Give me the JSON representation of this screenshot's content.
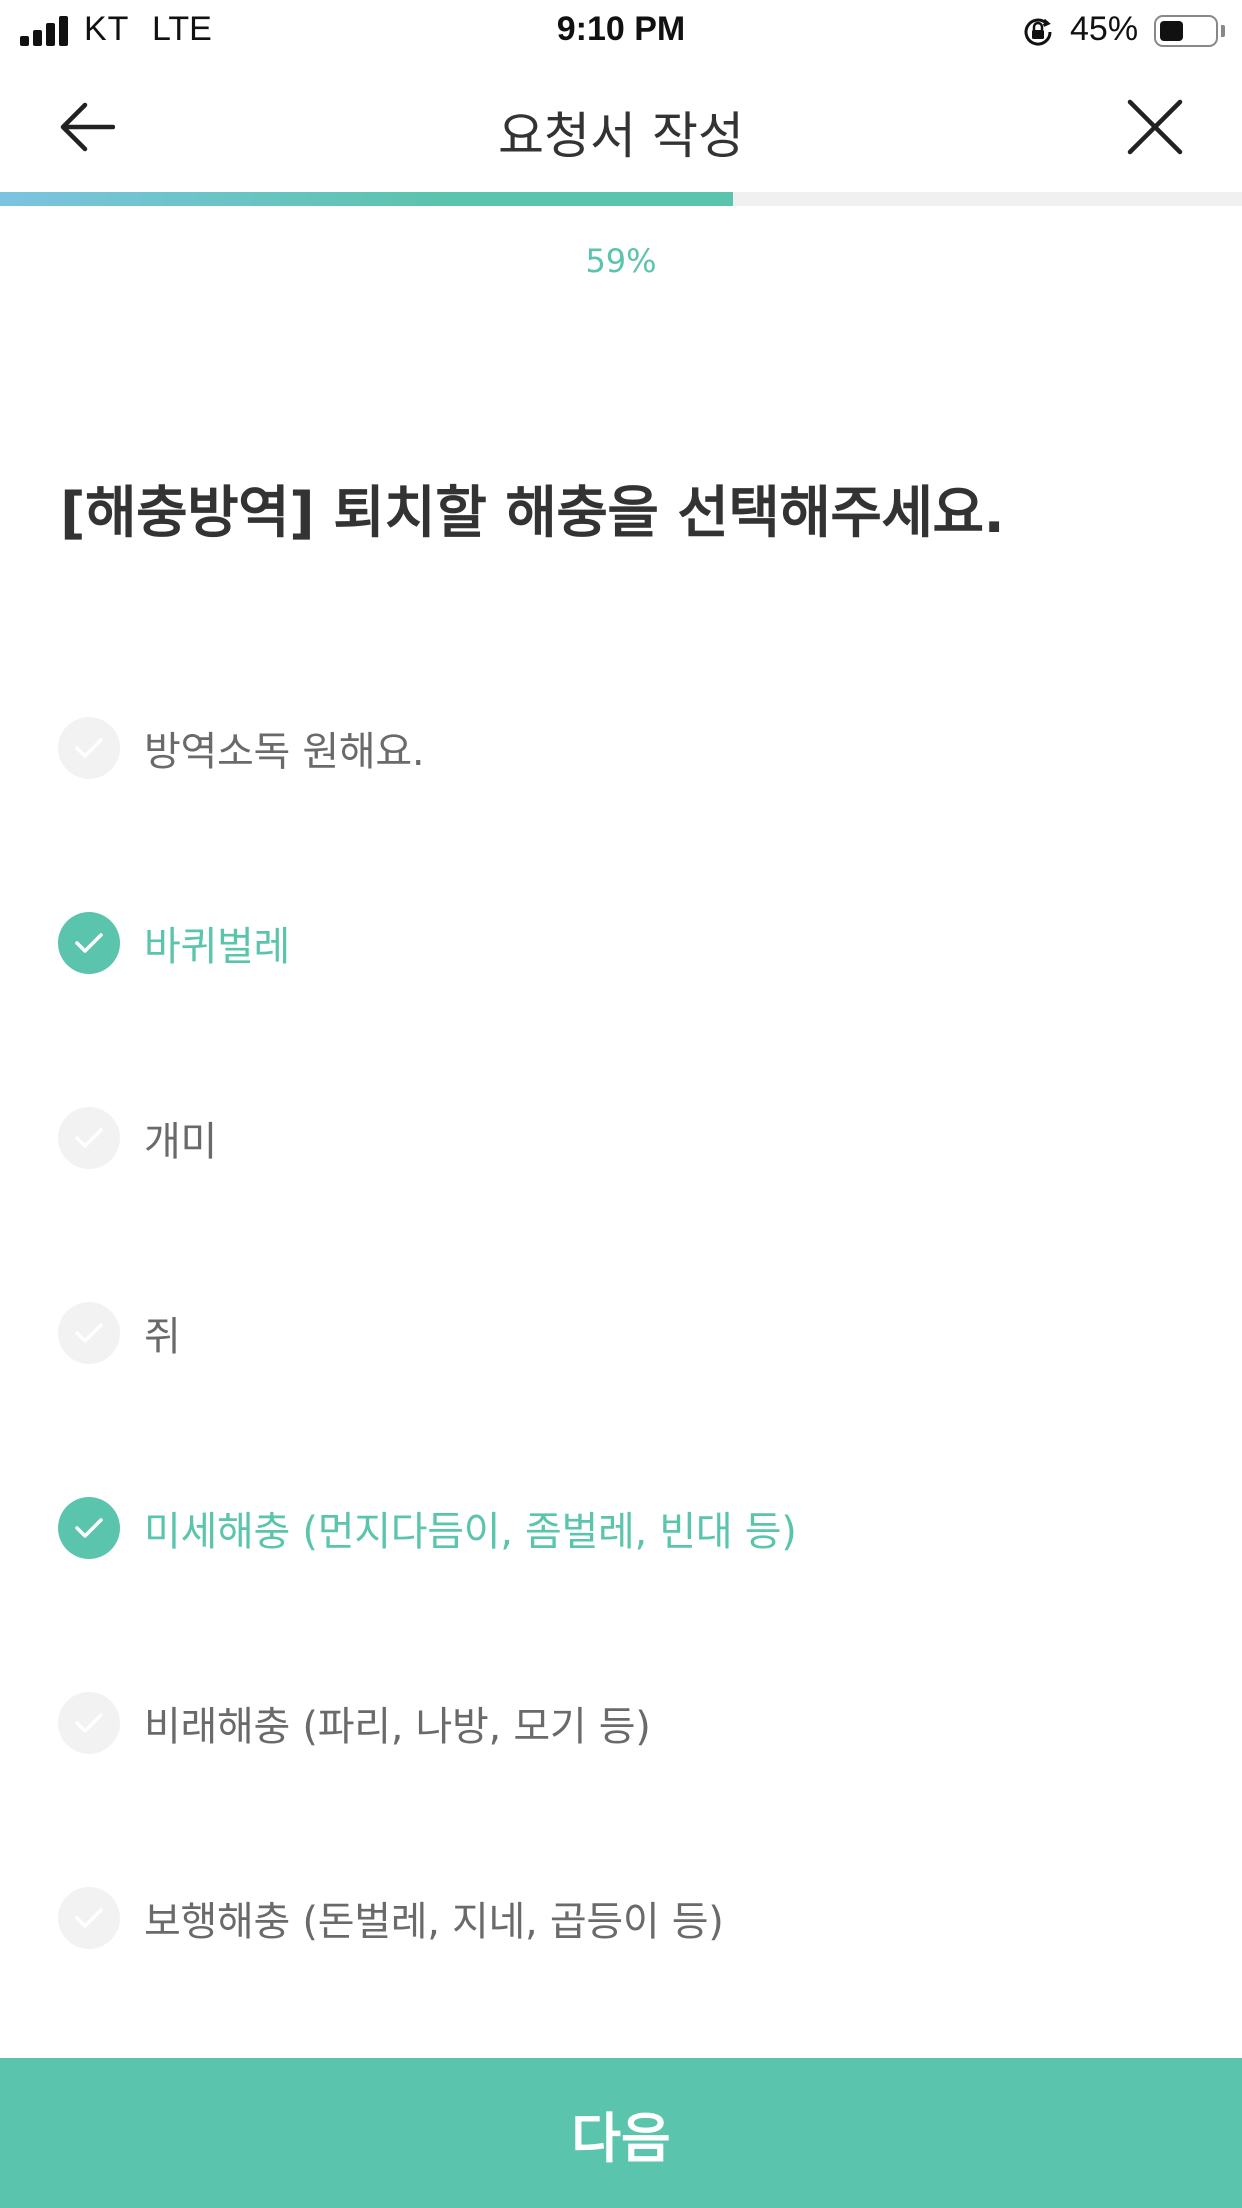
{
  "status_bar": {
    "carrier": "KT",
    "network": "LTE",
    "time": "9:10 PM",
    "battery_percent": "45%",
    "battery_level": 0.45,
    "icons": [
      "signal-icon",
      "rotation-lock-icon",
      "battery-icon"
    ]
  },
  "nav": {
    "title": "요청서 작성",
    "back_icon": "arrow-left-icon",
    "close_icon": "close-icon"
  },
  "progress": {
    "label": "59%",
    "value": 0.59,
    "colors": {
      "start": "#7bc4e0",
      "end": "#5bc4ac",
      "track": "#f0f0f0"
    }
  },
  "question": "[해충방역] 퇴치할 해충을 선택해주세요.",
  "options": [
    {
      "label": "방역소독 원해요.",
      "selected": false
    },
    {
      "label": "바퀴벌레",
      "selected": true
    },
    {
      "label": "개미",
      "selected": false
    },
    {
      "label": "쥐",
      "selected": false
    },
    {
      "label": "미세해충 (먼지다듬이, 좀벌레, 빈대 등)",
      "selected": true
    },
    {
      "label": "비래해충 (파리, 나방, 모기 등)",
      "selected": false
    },
    {
      "label": "보행해충 (돈벌레, 지네, 곱등이 등)",
      "selected": false
    }
  ],
  "next_button": {
    "label": "다음"
  },
  "colors": {
    "accent": "#5bc4ac",
    "text": "#333333",
    "muted": "#6a6a6a"
  }
}
